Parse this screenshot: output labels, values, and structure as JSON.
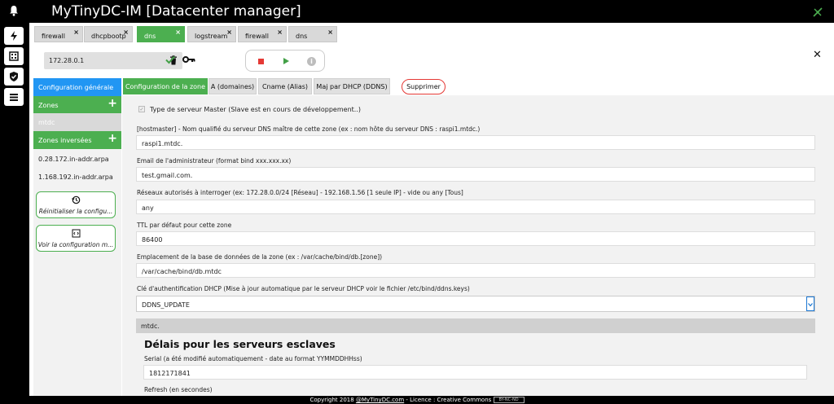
{
  "app": {
    "title": "MyTinyDC-IM [Datacenter manager]"
  },
  "tabs": [
    {
      "label": "firewall",
      "close": "×"
    },
    {
      "label": "dhcpbootp",
      "close": "×"
    },
    {
      "label": "dns",
      "close": "×"
    },
    {
      "label": "logstream",
      "close": "×"
    },
    {
      "label": "firewall",
      "close": "×"
    },
    {
      "label": "dns",
      "close": "×"
    }
  ],
  "toolbar": {
    "server_ip": "172.28.0.1",
    "info_glyph": "i",
    "close_glyph": "✕"
  },
  "sidebar": {
    "general": "Configuration générale",
    "zones_header": "Zones",
    "plus": "+",
    "zones": [
      "mtdc"
    ],
    "reverse_header": "Zones inversées",
    "reverse_zones": [
      "0.28.172.in-addr.arpa",
      "1.168.192.in-addr.arpa"
    ],
    "reset_label": "Réinitialiser la configu...",
    "view_label": "Voir la configuration m..."
  },
  "subtabs": {
    "zone_config": "Configuration de la zone",
    "a_records": "A (domaines)",
    "cname": "Cname (Alias)",
    "ddns": "Maj par DHCP (DDNS)",
    "delete": "Supprimer"
  },
  "form": {
    "master_check": "✓",
    "master_label": "Type de serveur Master (Slave est en cours de développement..)",
    "hostmaster_label": "[hostmaster] - Nom qualifié du serveur DNS maître de cette zone (ex : nom hôte du serveur DNS : raspi1.mtdc.)",
    "hostmaster_value": "raspi1.mtdc.",
    "email_label": "Email de l'administrateur (format bind xxx.xxx.xx)",
    "email_value": "test.gmail.com.",
    "networks_label": "Réseaux autorisés à interroger (ex: 172.28.0.0/24 [Réseau] - 192.168.1.56 [1 seule IP] - vide ou any [Tous]",
    "networks_value": "any",
    "ttl_label": "TTL par défaut pour cette zone",
    "ttl_value": "86400",
    "location_label": "Emplacement de la base de données de la zone (ex : /var/cache/bind/db.[zone])",
    "location_value": "/var/cache/bind/db.mtdc",
    "dhcp_key_label": "Clé d'authentification DHCP (Mise à jour automatique par le serveur DHCP voir le fichier /etc/bind/ddns.keys)",
    "dhcp_key_value": "DDNS_UPDATE",
    "zone_name": "mtdc.",
    "slave_heading": "Délais pour les serveurs esclaves",
    "serial_label": "Serial (a été modifié automatiquement - date au format YYMMDDHHss)",
    "serial_value": "1812171841",
    "refresh_label": "Refresh (en secondes)"
  },
  "footer": {
    "prefix": "Copyright 2018 ",
    "link": "@MyTinyDC.com",
    "suffix": " - Licence : Creative Commons ",
    "badge": "BY-NC-ND"
  },
  "colors": {
    "accent_green": "#4caf50",
    "accent_blue": "#2196f3",
    "danger": "#e53935"
  }
}
